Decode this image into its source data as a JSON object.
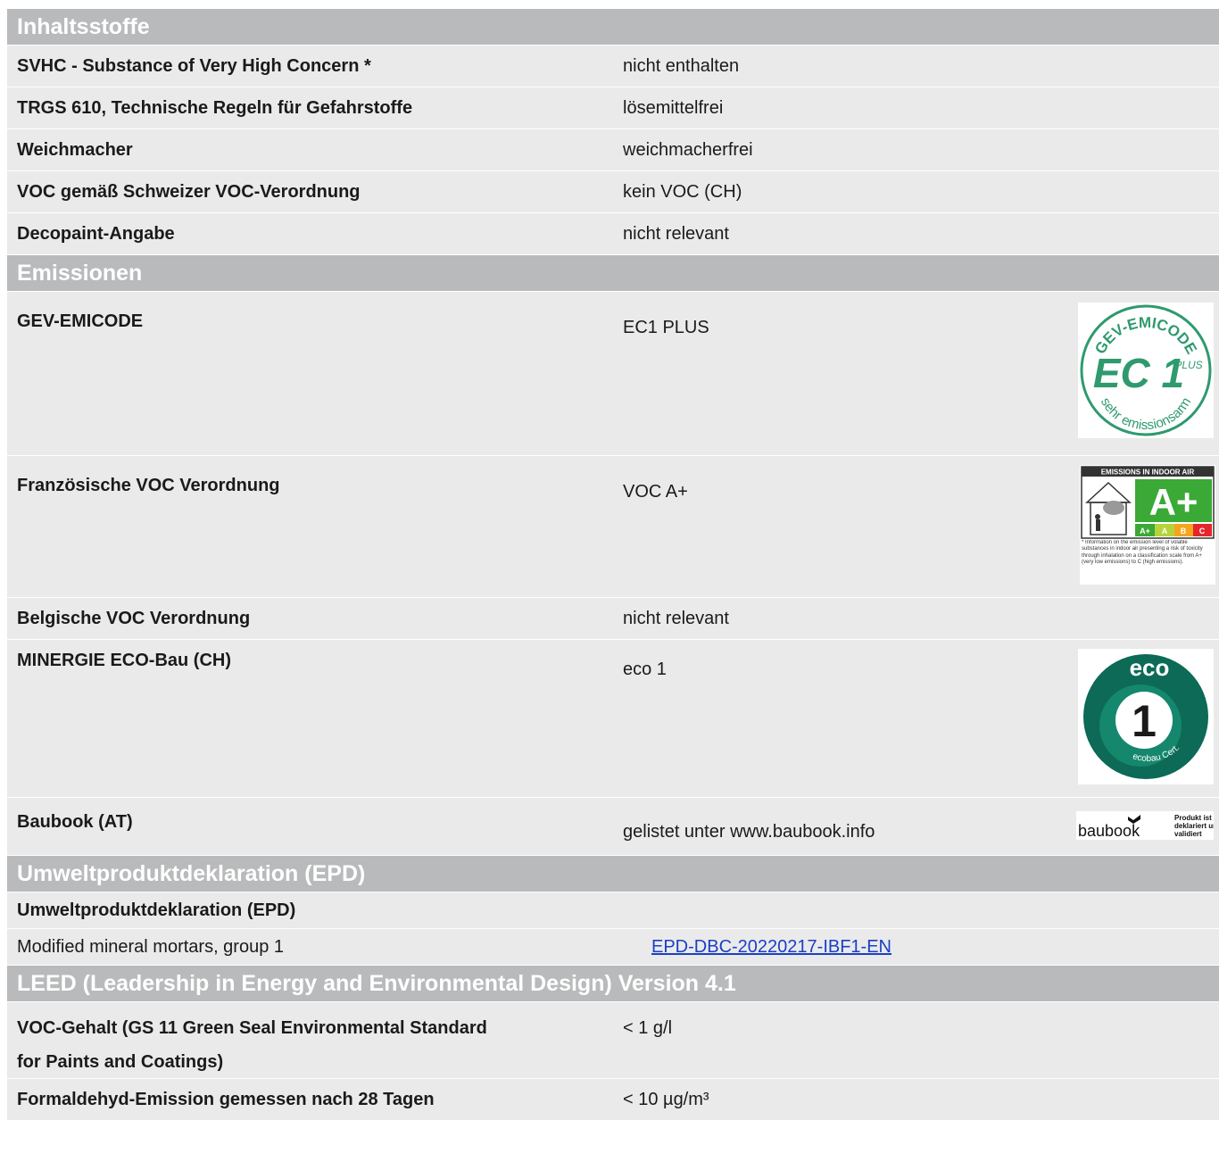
{
  "sections": {
    "inhaltsstoffe": {
      "title": "Inhaltsstoffe",
      "rows": [
        {
          "label": "SVHC - Substance of Very High Concern *",
          "value": "nicht enthalten"
        },
        {
          "label": "TRGS 610, Technische Regeln für Gefahrstoffe",
          "value": "lösemittelfrei"
        },
        {
          "label": "Weichmacher",
          "value": "weichmacherfrei"
        },
        {
          "label": "VOC gemäß Schweizer VOC-Verordnung",
          "value": "kein VOC (CH)"
        },
        {
          "label": "Decopaint-Angabe",
          "value": "nicht relevant"
        }
      ]
    },
    "emissionen": {
      "title": "Emissionen",
      "rows": [
        {
          "label": "GEV-EMICODE",
          "value": "EC1 PLUS",
          "logo": {
            "icon": "gev-emicode-ec1-plus-logo",
            "ring_top": "GEV-EMICODE",
            "center": "EC 1",
            "plus": "PLUS",
            "ring_bottom": "sehr emissionsarm",
            "color": "#2e9a6e"
          }
        },
        {
          "label": "Französische VOC Verordnung",
          "value": "VOC A+",
          "logo": {
            "icon": "emissions-indoor-air-label",
            "title": "EMISSIONS IN INDOOR AIR",
            "grade": "A+",
            "scale": [
              "A+",
              "A",
              "B",
              "C"
            ],
            "footnote": "* Information on the emission level of volatile substances in indoor air presenting a risk of toxicity through inhalation on a classification scale from A+ (very low emissions) to C (high emissions).",
            "colors": {
              "aplus": "#3aa935",
              "a": "#b6d33b",
              "b": "#f4a51c",
              "c": "#e3262b"
            }
          }
        },
        {
          "label": "Belgische VOC Verordnung",
          "value": "nicht relevant"
        },
        {
          "label": "MINERGIE ECO-Bau (CH)",
          "value": "eco 1",
          "logo": {
            "icon": "minergie-eco-1-logo",
            "top": "eco",
            "number": "1",
            "bottom": "ecobau Cert.",
            "color": "#0c6a56"
          }
        },
        {
          "label": "Baubook (AT)",
          "value": "gelistet unter www.baubook.info",
          "logo": {
            "icon": "baubook-logo",
            "brand": "baubook",
            "line1": "Produkt ist",
            "line2": "deklariert und",
            "line3": "validiert"
          }
        }
      ]
    },
    "epd": {
      "title": "Umweltproduktdeklaration (EPD)",
      "subheading": "Umweltproduktdeklaration (EPD)",
      "row": {
        "label": "Modified mineral mortars, group 1",
        "link": "EPD-DBC-20220217-IBF1-EN"
      }
    },
    "leed": {
      "title": "LEED (Leadership in Energy and Environmental Design) Version 4.1",
      "rows": [
        {
          "label_line1": "VOC-Gehalt (GS 11 Green Seal Environmental Standard",
          "label_line2": "for Paints and Coatings)",
          "value": "< 1 g/l"
        },
        {
          "label": "Formaldehyd-Emission gemessen nach 28 Tagen",
          "value": "< 10 µg/m³"
        }
      ]
    }
  }
}
